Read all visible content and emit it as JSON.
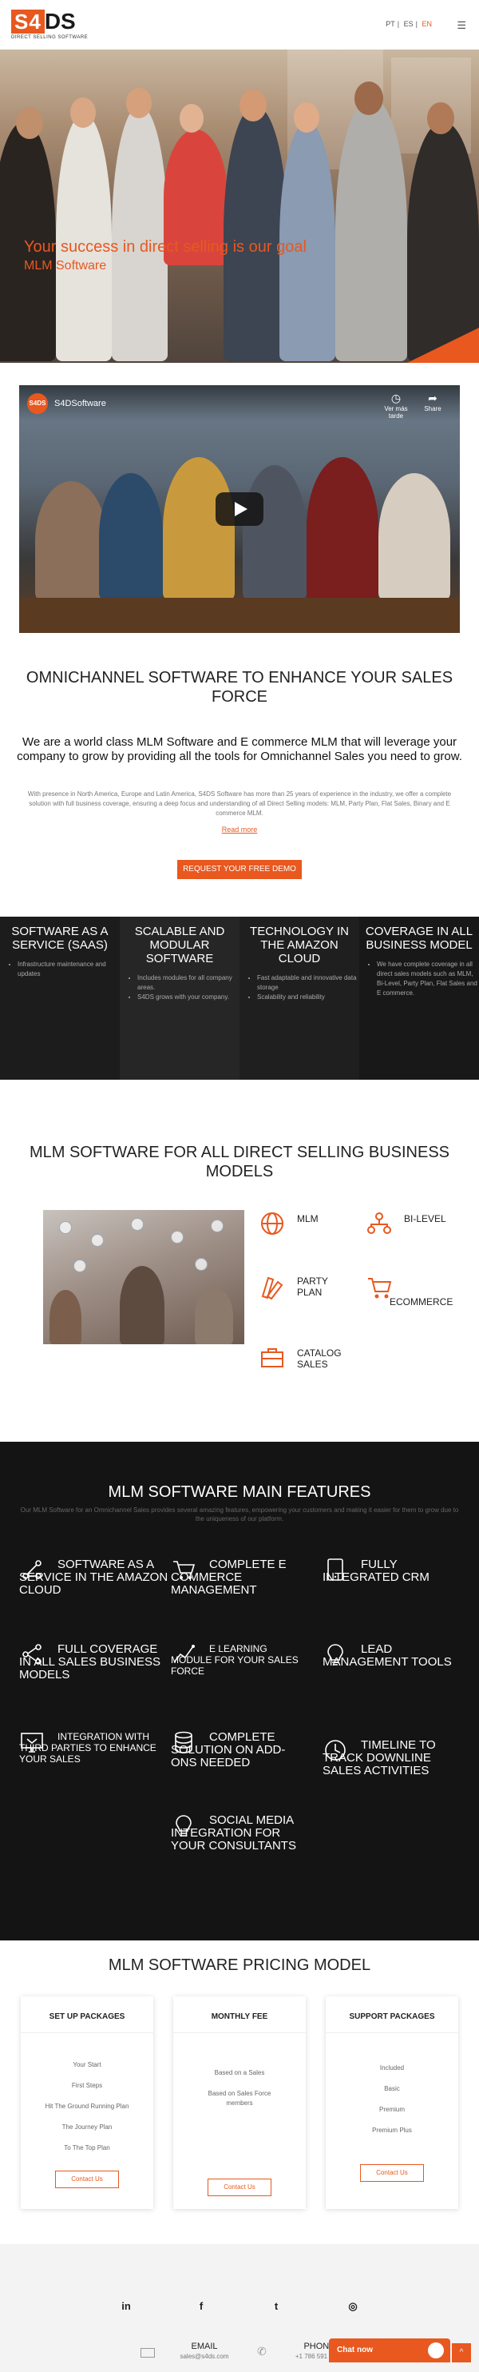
{
  "brand": {
    "logo_badge": "S4",
    "logo_rest": "DS",
    "logo_sub": "DIRECT SELLING SOFTWARE",
    "accent": "#e8581f"
  },
  "header": {
    "languages": [
      {
        "code": "PT",
        "active": false
      },
      {
        "code": "ES",
        "active": false
      },
      {
        "code": "EN",
        "active": true
      }
    ],
    "menu_icon": "hamburger-icon"
  },
  "hero": {
    "title": "Your success in direct selling is our goal",
    "subtitle": "MLM Software"
  },
  "video": {
    "channel": "S4DS",
    "title": "S4DSoftware",
    "watch_later": "Ver más tarde",
    "share": "Share"
  },
  "omni": {
    "title": "OMNICHANNEL SOFTWARE TO ENHANCE YOUR SALES FORCE",
    "lead": "We are a world class MLM Software and E commerce MLM that will leverage your company to grow by providing all the tools for Omnichannel Sales you need to grow.",
    "body": "With presence in North America, Europe and Latin America, S4DS Software has more than 25 years of experience in the industry, we offer a complete solution with full business coverage, ensuring a deep focus and understanding of all Direct Selling models: MLM, Party Plan, Flat Sales, Binary and E commerce MLM.",
    "read_more": "Read more",
    "cta": "REQUEST YOUR FREE DEMO"
  },
  "band": [
    {
      "title": "SOFTWARE AS A SERVICE (SAAS)",
      "items": [
        "Infrastructure maintenance and updates"
      ]
    },
    {
      "title": "SCALABLE AND MODULAR SOFTWARE",
      "items": [
        "Includes modules for all company areas.",
        "S4DS grows with your company."
      ]
    },
    {
      "title": "TECHNOLOGY IN THE AMAZON CLOUD",
      "items": [
        "Fast adaptable and innovative data storage",
        "Scalability and reliability"
      ]
    },
    {
      "title": "COVERAGE IN ALL BUSINESS MODEL",
      "items": [
        "We have complete coverage in all direct sales models such as MLM, Bi-Level, Party Plan, Flat Sales and E commerce."
      ]
    }
  ],
  "business_models": {
    "title": "MLM SOFTWARE FOR ALL DIRECT SELLING BUSINESS MODELS",
    "items": [
      {
        "label": "MLM",
        "icon": "globe-icon"
      },
      {
        "label": "BI-LEVEL",
        "icon": "network-icon"
      },
      {
        "label": "PARTY PLAN",
        "icon": "swatches-icon"
      },
      {
        "label": "ECOMMERCE",
        "icon": "cart-icon"
      },
      {
        "label": "CATALOG SALES",
        "icon": "briefcase-icon"
      }
    ]
  },
  "features": {
    "title": "MLM SOFTWARE MAIN FEATURES",
    "subtitle": "Our MLM Software for an Omnichannel Sales provides several amazing features, empowering your customers and making it easier for them to grow due to the uniqueness of our platform.",
    "items": [
      {
        "label": "SOFTWARE AS A SERVICE IN THE AMAZON CLOUD",
        "icon": "nodes-icon"
      },
      {
        "label": "COMPLETE E COMMERCE MANAGEMENT",
        "icon": "cart-icon"
      },
      {
        "label": "FULLY INTEGRATED CRM",
        "icon": "tablet-icon"
      },
      {
        "label": "FULL COVERAGE IN ALL SALES BUSINESS MODELS",
        "icon": "share-icon"
      },
      {
        "label": "E LEARNING MODULE FOR YOUR SALES FORCE",
        "icon": "trend-icon"
      },
      {
        "label": "LEAD MANAGEMENT TOOLS",
        "icon": "bulb-icon"
      },
      {
        "label": "INTEGRATION WITH THIRD PARTIES TO ENHANCE YOUR SALES",
        "icon": "integration-icon"
      },
      {
        "label": "COMPLETE SOLUTION ON ADD-ONS NEEDED",
        "icon": "database-icon"
      },
      {
        "label": "TIMELINE TO TRACK DOWNLINE SALES ACTIVITIES",
        "icon": "clock-icon"
      },
      {
        "label": "SOCIAL MEDIA INTEGRATION FOR YOUR CONSULTANTS",
        "icon": "bulb-icon"
      }
    ]
  },
  "pricing": {
    "title": "MLM SOFTWARE PRICING MODEL",
    "cards": [
      {
        "title": "SET UP PACKAGES",
        "rows": [
          "Your Start",
          "First Steps",
          "Hit The Ground Running Plan",
          "The Journey Plan",
          "To The Top Plan"
        ],
        "button": "Contact Us"
      },
      {
        "title": "MONTHLY FEE",
        "rows": [
          "Based on a Sales",
          "Based on Sales Force members"
        ],
        "button": "Contact Us"
      },
      {
        "title": "SUPPORT PACKAGES",
        "rows": [
          "Included",
          "Basic",
          "Premium",
          "Premium Plus"
        ],
        "button": "Contact Us"
      }
    ]
  },
  "footer": {
    "social": [
      {
        "name": "linkedin-icon",
        "glyph": "in"
      },
      {
        "name": "facebook-icon",
        "glyph": "f"
      },
      {
        "name": "twitter-icon",
        "glyph": "t"
      },
      {
        "name": "instagram-icon",
        "glyph": "◎"
      }
    ],
    "email_label": "EMAIL",
    "email_value": "sales@s4ds.com",
    "phone_label": "PHONE",
    "phone_value": "+1 786 591 7790",
    "chat_label": "Chat now",
    "back_to_top": "^"
  }
}
